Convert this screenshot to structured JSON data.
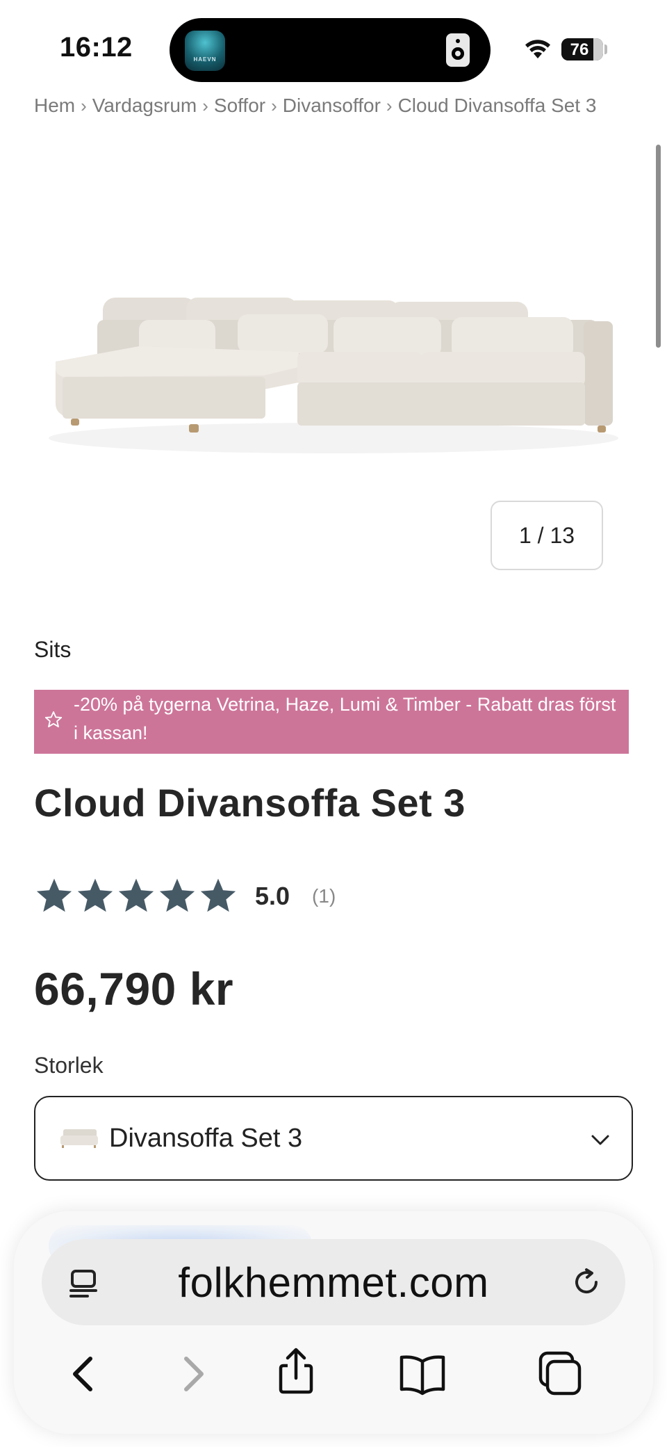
{
  "status_bar": {
    "time": "16:12",
    "island_app_label": "HAEVN",
    "battery_level": "76",
    "battery_fraction": 0.76
  },
  "breadcrumb": [
    "Hem",
    "Vardagsrum",
    "Soffor",
    "Divansoffor",
    "Cloud Divansoffa Set 3"
  ],
  "breadcrumb_separator": "›",
  "gallery": {
    "counter": "1 / 13"
  },
  "product": {
    "section": "Sits",
    "promo_text": "-20% på tygerna Vetrina, Haze, Lumi & Timber - Rabatt dras först i kassan!",
    "promo_color": "#cd7599",
    "title": "Cloud Divansoffa Set 3",
    "rating_value": "5.0",
    "rating_count": "(1)",
    "rating_stars": 5,
    "star_color": "#465a66",
    "price": "66,790 kr",
    "size_label": "Storlek",
    "size_selected": "Divansoffa Set 3"
  },
  "browser": {
    "url": "folkhemmet.com",
    "icons": [
      "page-menu-icon",
      "reload-icon",
      "back-icon",
      "forward-icon",
      "share-icon",
      "bookmarks-icon",
      "tabs-icon"
    ]
  }
}
